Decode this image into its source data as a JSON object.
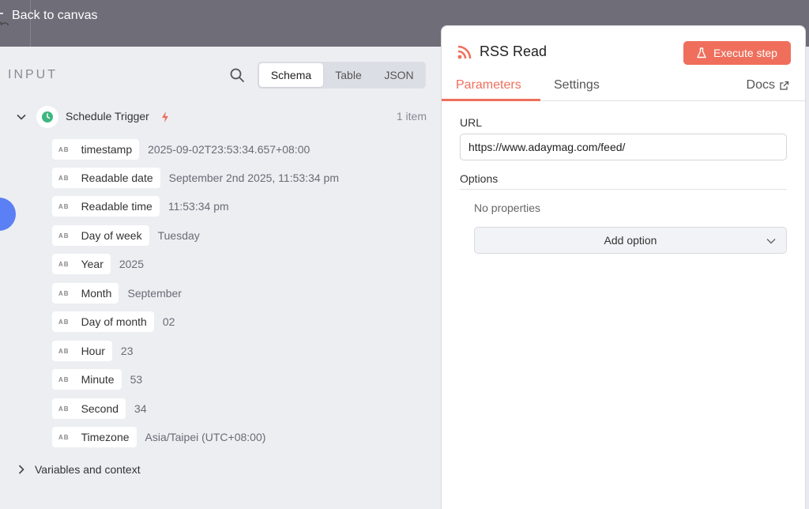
{
  "topbar": {
    "back_label": "Back to canvas"
  },
  "input": {
    "title": "INPUT",
    "view_tabs": [
      {
        "label": "Schema",
        "active": true
      },
      {
        "label": "Table",
        "active": false
      },
      {
        "label": "JSON",
        "active": false
      }
    ],
    "trigger": {
      "name": "Schedule Trigger",
      "count": "1 item"
    },
    "fields": [
      {
        "type": "AB",
        "name": "timestamp",
        "value": "2025-09-02T23:53:34.657+08:00"
      },
      {
        "type": "AB",
        "name": "Readable date",
        "value": "September 2nd 2025, 11:53:34 pm"
      },
      {
        "type": "AB",
        "name": "Readable time",
        "value": "11:53:34 pm"
      },
      {
        "type": "AB",
        "name": "Day of week",
        "value": "Tuesday"
      },
      {
        "type": "AB",
        "name": "Year",
        "value": "2025"
      },
      {
        "type": "AB",
        "name": "Month",
        "value": "September"
      },
      {
        "type": "AB",
        "name": "Day of month",
        "value": "02"
      },
      {
        "type": "AB",
        "name": "Hour",
        "value": "23"
      },
      {
        "type": "AB",
        "name": "Minute",
        "value": "53"
      },
      {
        "type": "AB",
        "name": "Second",
        "value": "34"
      },
      {
        "type": "AB",
        "name": "Timezone",
        "value": "Asia/Taipei (UTC+08:00)"
      }
    ],
    "variables_label": "Variables and context"
  },
  "node": {
    "title": "RSS Read",
    "execute_label": "Execute step",
    "tabs": [
      {
        "label": "Parameters",
        "active": true
      },
      {
        "label": "Settings",
        "active": false
      }
    ],
    "docs_label": "Docs",
    "url_label": "URL",
    "url_value": "https://www.adaymag.com/feed/",
    "options_label": "Options",
    "no_properties": "No properties",
    "add_option_label": "Add option"
  },
  "colors": {
    "accent": "#ef6f5c",
    "topbar": "#6f6e78",
    "trigger_icon": "#3fb680"
  }
}
